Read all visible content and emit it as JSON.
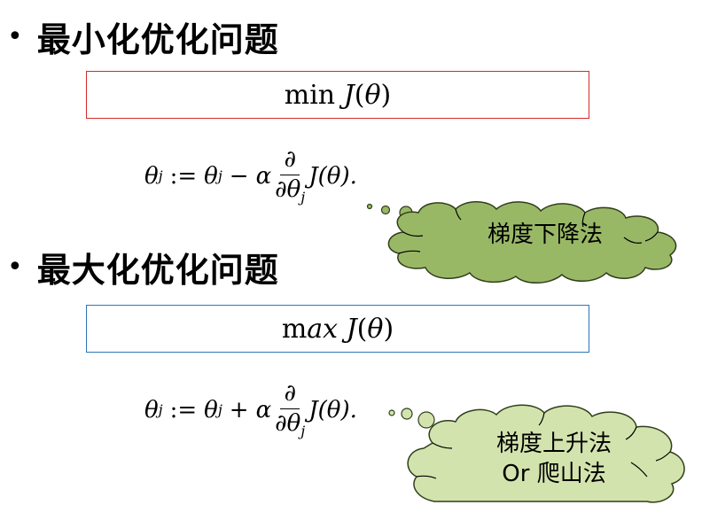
{
  "section1": {
    "bullet": "•",
    "heading": "最小化优化问题",
    "box_op": "min",
    "box_func": "J",
    "box_var": "θ",
    "formula": {
      "lhs": "θ",
      "sub": "j",
      "assign": ":=",
      "op": "−",
      "alpha": "α",
      "partial": "∂",
      "func": "J(θ)."
    },
    "cloud": {
      "line1": "梯度下降法"
    }
  },
  "section2": {
    "bullet": "•",
    "heading": "最大化优化问题",
    "box_op_m": "m",
    "box_op_ax": "ax",
    "box_func": "J",
    "box_var": "θ",
    "formula": {
      "lhs": "θ",
      "sub": "j",
      "assign": ":=",
      "op": "+",
      "alpha": "α",
      "partial": "∂",
      "func": "J(θ)."
    },
    "cloud": {
      "line1": "梯度上升法",
      "line2": "Or 爬山法"
    }
  },
  "colors": {
    "box1_border": "#d62828",
    "box2_border": "#2e75b6",
    "cloud1_fill": "#99b866",
    "cloud2_fill": "#d3e3ad",
    "cloud_stroke": "#2f3e1a"
  }
}
